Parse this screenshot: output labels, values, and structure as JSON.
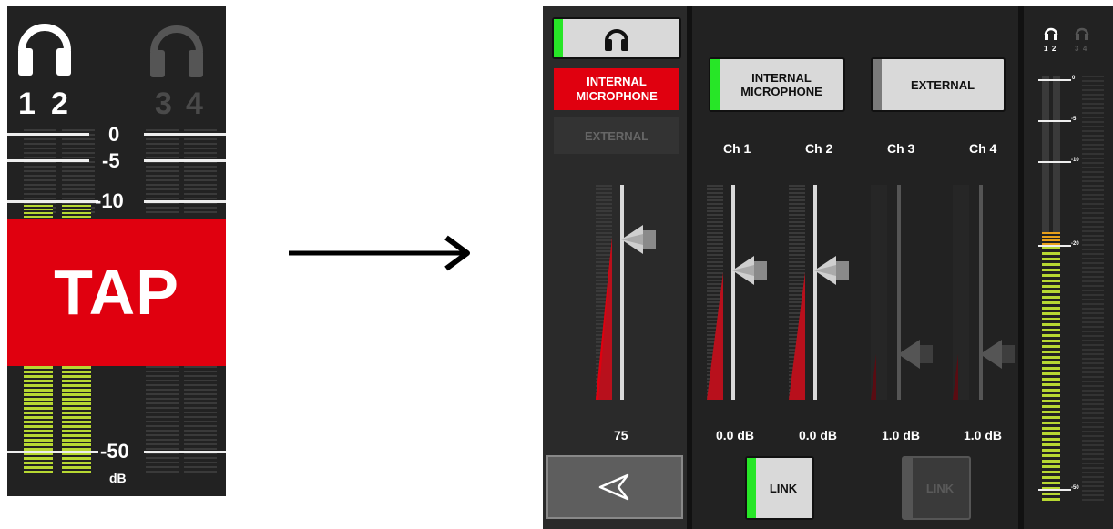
{
  "tap_panel": {
    "headphones_active": [
      "1",
      "2"
    ],
    "headphones_inactive": [
      "3",
      "4"
    ],
    "scale": [
      "0",
      "-5",
      "-10",
      "-50"
    ],
    "unit": "dB",
    "tap_label": "TAP"
  },
  "mixer": {
    "left_column": {
      "internal_mic_label": "INTERNAL\nMICROPHONE",
      "external_label": "EXTERNAL",
      "value": "75",
      "level": 0.75
    },
    "top_buttons": {
      "internal_mic_label": "INTERNAL\nMICROPHONE",
      "external_label": "EXTERNAL"
    },
    "channels": [
      {
        "label": "Ch 1",
        "value": "0.0 dB",
        "active": true
      },
      {
        "label": "Ch 2",
        "value": "0.0 dB",
        "active": true
      },
      {
        "label": "Ch 3",
        "value": "1.0 dB",
        "active": false
      },
      {
        "label": "Ch 4",
        "value": "1.0 dB",
        "active": false
      }
    ],
    "link_labels": [
      "LINK",
      "LINK"
    ],
    "meter": {
      "headphone_numbers_active": "1  2",
      "headphone_numbers_inactive": "3  4",
      "scale": [
        "0",
        "-5",
        "-10",
        "-20",
        "-50"
      ]
    }
  },
  "colors": {
    "red": "#e0000f",
    "green": "#27e627",
    "yellow_green": "#b7d832",
    "panel": "#222222"
  }
}
